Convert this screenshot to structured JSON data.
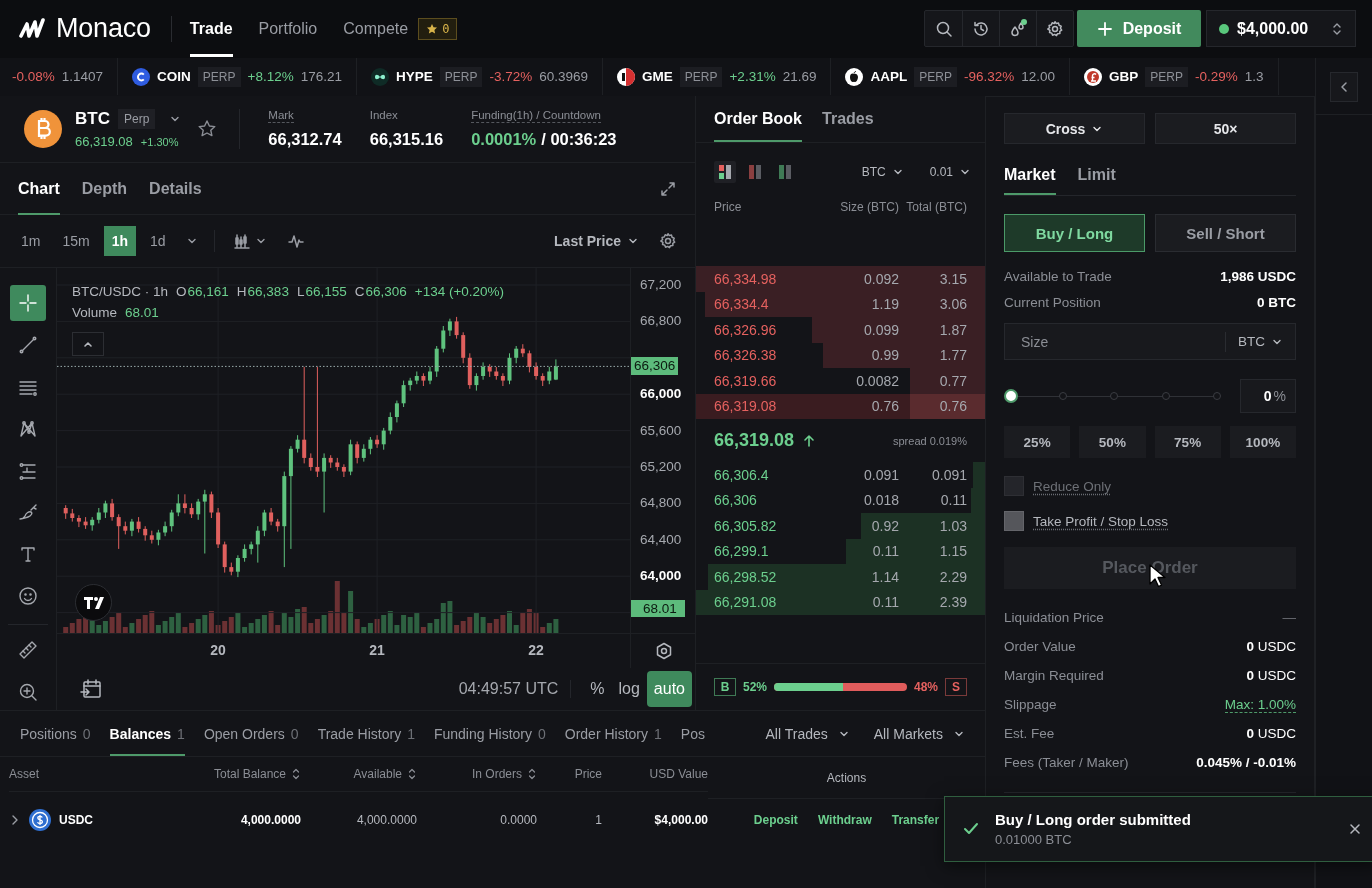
{
  "topbar": {
    "brand": "Monaco",
    "nav": [
      {
        "label": "Trade",
        "selected": true
      },
      {
        "label": "Portfolio",
        "selected": false
      },
      {
        "label": "Compete",
        "selected": false,
        "badge": "0"
      }
    ],
    "tool_buttons": [
      {
        "kind": "search",
        "alert": false
      },
      {
        "kind": "history",
        "alert": false
      },
      {
        "kind": "rewards",
        "alert": true
      },
      {
        "kind": "settings",
        "alert": false
      }
    ],
    "deposit_button": "Deposit",
    "account": {
      "balance": "$4,000.00",
      "connected": true
    }
  },
  "ticker": [
    {
      "change": "-0.08%",
      "rising": false,
      "price": "1.1407"
    },
    {
      "kind": "coin",
      "symbol": "COIN",
      "tag": "PERP",
      "change": "+8.12%",
      "rising": true,
      "price": "176.21"
    },
    {
      "kind": "hype",
      "symbol": "HYPE",
      "tag": "PERP",
      "change": "-3.72%",
      "rising": false,
      "price": "60.3969"
    },
    {
      "kind": "gme",
      "symbol": "GME",
      "tag": "PERP",
      "change": "+2.31%",
      "rising": true,
      "price": "21.69"
    },
    {
      "kind": "aapl",
      "symbol": "AAPL",
      "tag": "PERP",
      "change": "-96.32%",
      "rising": false,
      "price": "12.00"
    },
    {
      "kind": "gbp",
      "symbol": "GBP",
      "tag": "PERP",
      "change": "-0.29%",
      "rising": false,
      "price": "1.3"
    }
  ],
  "market": {
    "symbol": "BTC",
    "tag": "Perp",
    "price": "66,319.08",
    "change": "+1.30%",
    "rising": true,
    "favorite": false,
    "stats": [
      {
        "label": "Mark",
        "value": "66,312.74",
        "underlined": true,
        "positive": false
      },
      {
        "label": "Index",
        "value": "66,315.16",
        "underlined": false,
        "positive": false
      },
      {
        "label": "Funding(1h) / Countdown",
        "value": "0.0001%",
        "countdown": "/ 00:36:23",
        "underlined": true,
        "positive": true
      }
    ]
  },
  "chart_panel": {
    "tabs": [
      {
        "label": "Chart",
        "selected": true
      },
      {
        "label": "Depth",
        "selected": false
      },
      {
        "label": "Details",
        "selected": false
      }
    ],
    "intervals": [
      {
        "label": "1m",
        "selected": false
      },
      {
        "label": "15m",
        "selected": false
      },
      {
        "label": "1h",
        "selected": true
      },
      {
        "label": "1d",
        "selected": false
      }
    ],
    "price_source": "Last Price",
    "tools": [
      {
        "kind": "crosshair",
        "selected": true
      },
      {
        "kind": "trend-line",
        "selected": false
      },
      {
        "kind": "parallel-lines",
        "selected": false
      },
      {
        "kind": "pattern",
        "selected": false
      },
      {
        "kind": "position",
        "selected": false
      },
      {
        "kind": "brush",
        "selected": false
      },
      {
        "kind": "text",
        "selected": false
      },
      {
        "kind": "emoji",
        "selected": false
      },
      {
        "kind": "ruler",
        "selected": false
      },
      {
        "kind": "zoom",
        "selected": false
      }
    ],
    "legend": {
      "pair": "BTC/USDC · 1h",
      "ohlc": [
        {
          "key": "O",
          "value": "66,161"
        },
        {
          "key": "H",
          "value": "66,383"
        },
        {
          "key": "L",
          "value": "66,155"
        },
        {
          "key": "C",
          "value": "66,306"
        }
      ],
      "change": "+134 (+0.20%)",
      "volume_label": "Volume",
      "volume": "68.01"
    },
    "chart_data": {
      "type": "candlestick",
      "ylim": [
        63376,
        67387
      ],
      "yticks": [
        {
          "value": 67200,
          "label": "67,200"
        },
        {
          "value": 66800,
          "label": "66,800"
        },
        {
          "value": 66000,
          "label": "66,000"
        },
        {
          "value": 65600,
          "label": "65,600"
        },
        {
          "value": 65200,
          "label": "65,200"
        },
        {
          "value": 64800,
          "label": "64,800"
        },
        {
          "value": 64400,
          "label": "64,400"
        },
        {
          "value": 64000,
          "label": "64,000"
        }
      ],
      "xlim": [
        18.987,
        23.006
      ],
      "grid": true,
      "ref_lines": [
        {
          "axis": "y",
          "value": 66306,
          "label": "66,306"
        }
      ],
      "xticks": [
        {
          "value": 20,
          "label": "20"
        },
        {
          "value": 21,
          "label": "21"
        },
        {
          "value": 22,
          "label": "22"
        }
      ],
      "x": [
        19.0417,
        19.0833,
        19.125,
        19.1667,
        19.2083,
        19.25,
        19.2917,
        19.3333,
        19.375,
        19.4167,
        19.4583,
        19.5,
        19.5417,
        19.5833,
        19.625,
        19.6667,
        19.7083,
        19.75,
        19.7917,
        19.8333,
        19.875,
        19.9167,
        19.9583,
        20,
        20.0417,
        20.0833,
        20.125,
        20.1667,
        20.2083,
        20.25,
        20.2917,
        20.3333,
        20.375,
        20.4167,
        20.4583,
        20.5,
        20.5417,
        20.5833,
        20.625,
        20.6667,
        20.7083,
        20.75,
        20.7917,
        20.8333,
        20.875,
        20.9167,
        20.9583,
        21,
        21.0417,
        21.0833,
        21.125,
        21.1667,
        21.2083,
        21.25,
        21.2917,
        21.3333,
        21.375,
        21.4167,
        21.4583,
        21.5,
        21.5417,
        21.5833,
        21.625,
        21.6667,
        21.7083,
        21.75,
        21.7917,
        21.8333,
        21.875,
        21.9167,
        21.9583,
        22,
        22.0417,
        22.0833,
        22.125
      ],
      "ohlc": [
        [
          64750,
          64780,
          64630,
          64690
        ],
        [
          64690,
          64740,
          64600,
          64640
        ],
        [
          64640,
          64670,
          64540,
          64600
        ],
        [
          64600,
          64650,
          64520,
          64560
        ],
        [
          64560,
          64650,
          64500,
          64620
        ],
        [
          64620,
          64750,
          64580,
          64700
        ],
        [
          64700,
          64830,
          64640,
          64800
        ],
        [
          64800,
          64850,
          64610,
          64650
        ],
        [
          64650,
          64680,
          64300,
          64550
        ],
        [
          64550,
          64600,
          64460,
          64500
        ],
        [
          64500,
          64630,
          64440,
          64600
        ],
        [
          64600,
          64650,
          64480,
          64520
        ],
        [
          64520,
          64550,
          64390,
          64450
        ],
        [
          64450,
          64500,
          64360,
          64400
        ],
        [
          64400,
          64510,
          64340,
          64480
        ],
        [
          64480,
          64600,
          64440,
          64550
        ],
        [
          64550,
          64730,
          64490,
          64700
        ],
        [
          64700,
          64900,
          64660,
          64800
        ],
        [
          64800,
          64900,
          64690,
          64750
        ],
        [
          64750,
          64800,
          64640,
          64680
        ],
        [
          64680,
          64850,
          64620,
          64820
        ],
        [
          64820,
          64950,
          64250,
          64900
        ],
        [
          64900,
          64930,
          64640,
          64700
        ],
        [
          64700,
          64750,
          64310,
          64350
        ],
        [
          64350,
          64380,
          64040,
          64100
        ],
        [
          64100,
          64150,
          64010,
          64050
        ],
        [
          64050,
          64230,
          63990,
          64200
        ],
        [
          64200,
          64350,
          64160,
          64300
        ],
        [
          64300,
          64380,
          64240,
          64350
        ],
        [
          64350,
          64550,
          64150,
          64500
        ],
        [
          64500,
          64730,
          64440,
          64700
        ],
        [
          64700,
          64750,
          64560,
          64600
        ],
        [
          64600,
          64630,
          64490,
          64550
        ],
        [
          64550,
          65150,
          64100,
          65100
        ],
        [
          65100,
          65430,
          64300,
          65400
        ],
        [
          65400,
          65550,
          65360,
          65500
        ],
        [
          65500,
          66300,
          65240,
          65300
        ],
        [
          65300,
          65350,
          65160,
          65200
        ],
        [
          65200,
          66300,
          65090,
          65150
        ],
        [
          65150,
          65350,
          64700,
          65300
        ],
        [
          65300,
          65330,
          65190,
          65250
        ],
        [
          65250,
          65300,
          65160,
          65200
        ],
        [
          65200,
          65230,
          65090,
          65150
        ],
        [
          65150,
          65500,
          65110,
          65450
        ],
        [
          65450,
          65480,
          65240,
          65300
        ],
        [
          65300,
          65450,
          65260,
          65400
        ],
        [
          65400,
          65530,
          65340,
          65500
        ],
        [
          65500,
          65550,
          65410,
          65450
        ],
        [
          65450,
          65630,
          65390,
          65600
        ],
        [
          65600,
          65800,
          65560,
          65750
        ],
        [
          65750,
          65930,
          65690,
          65900
        ],
        [
          65900,
          66150,
          65860,
          66100
        ],
        [
          66100,
          66180,
          66040,
          66150
        ],
        [
          66150,
          66250,
          66110,
          66200
        ],
        [
          66200,
          66230,
          66090,
          66150
        ],
        [
          66150,
          66300,
          66110,
          66250
        ],
        [
          66250,
          66530,
          66190,
          66500
        ],
        [
          66500,
          66750,
          66460,
          66700
        ],
        [
          66700,
          66830,
          66640,
          66800
        ],
        [
          66800,
          66850,
          66610,
          66650
        ],
        [
          66650,
          66680,
          66340,
          66400
        ],
        [
          66400,
          66450,
          66060,
          66100
        ],
        [
          66100,
          66230,
          66040,
          66200
        ],
        [
          66200,
          66350,
          66160,
          66300
        ],
        [
          66300,
          66330,
          66190,
          66250
        ],
        [
          66250,
          66300,
          66160,
          66200
        ],
        [
          66200,
          66230,
          66090,
          66150
        ],
        [
          66150,
          66450,
          66110,
          66400
        ],
        [
          66400,
          66530,
          66340,
          66500
        ],
        [
          66500,
          66550,
          66410,
          66450
        ],
        [
          66450,
          66480,
          66240,
          66300
        ],
        [
          66300,
          66350,
          66160,
          66200
        ],
        [
          66200,
          66230,
          66090,
          66150
        ],
        [
          66150,
          66300,
          66110,
          66250
        ],
        [
          66161,
          66383,
          66155,
          66306
        ]
      ]
    },
    "volume_tag": "68.01",
    "time": "04:49:57 UTC",
    "scale_buttons": [
      {
        "label": "%",
        "selected": false
      },
      {
        "label": "log",
        "selected": false
      },
      {
        "label": "auto",
        "selected": true
      }
    ]
  },
  "order_book": {
    "tabs": [
      {
        "label": "Order Book",
        "selected": true
      },
      {
        "label": "Trades",
        "selected": false
      }
    ],
    "view_modes": [
      {
        "kind": "both",
        "selected": true
      },
      {
        "kind": "asks",
        "selected": false
      },
      {
        "kind": "bids",
        "selected": false
      }
    ],
    "unit": "BTC",
    "tick_size": "0.01",
    "columns": [
      "Price",
      "Size (BTC)",
      "Total (BTC)"
    ],
    "asks": [
      {
        "price": "66,334.98",
        "size": "0.092",
        "total": "3.15",
        "level": 1,
        "highlighted": false
      },
      {
        "price": "66,334.4",
        "size": "1.19",
        "total": "3.06",
        "level": 0.97,
        "highlighted": false
      },
      {
        "price": "66,326.96",
        "size": "0.099",
        "total": "1.87",
        "level": 0.6,
        "highlighted": false
      },
      {
        "price": "66,326.38",
        "size": "0.99",
        "total": "1.77",
        "level": 0.56,
        "highlighted": false
      },
      {
        "price": "66,319.66",
        "size": "0.0082",
        "total": "0.77",
        "level": 0.26,
        "highlighted": false
      },
      {
        "price": "66,319.08",
        "size": "0.76",
        "total": "0.76",
        "level": 0.26,
        "highlighted": true
      }
    ],
    "mid_price": "66,319.08",
    "mid_rising": true,
    "spread": "spread 0.019%",
    "bids": [
      {
        "price": "66,306.4",
        "size": "0.091",
        "total": "0.091",
        "level": 0.04,
        "highlighted": false
      },
      {
        "price": "66,306",
        "size": "0.018",
        "total": "0.11",
        "level": 0.05,
        "highlighted": false
      },
      {
        "price": "66,305.82",
        "size": "0.92",
        "total": "1.03",
        "level": 0.43,
        "highlighted": false
      },
      {
        "price": "66,299.1",
        "size": "0.11",
        "total": "1.15",
        "level": 0.48,
        "highlighted": false
      },
      {
        "price": "66,298.52",
        "size": "1.14",
        "total": "2.29",
        "level": 0.96,
        "highlighted": false
      },
      {
        "price": "66,291.08",
        "size": "0.11",
        "total": "2.39",
        "level": 1,
        "highlighted": false
      }
    ],
    "balance": {
      "buy_label": "B",
      "buy_percent": "52%",
      "level": 0.52,
      "sell_percent": "48%",
      "sell_label": "S"
    }
  },
  "order_form": {
    "margin_mode": "Cross",
    "leverage": "50×",
    "tabs": [
      {
        "label": "Market",
        "selected": true
      },
      {
        "label": "Limit",
        "selected": false
      }
    ],
    "sides": [
      {
        "label": "Buy / Long",
        "kind": "buy",
        "selected": true
      },
      {
        "label": "Sell / Short",
        "kind": "sell",
        "selected": false
      }
    ],
    "summary": [
      {
        "label": "Available to Trade",
        "value": "1,986 USDC"
      },
      {
        "label": "Current Position",
        "value": "0 BTC"
      }
    ],
    "size_field": {
      "placeholder": "Size",
      "unit": "BTC"
    },
    "slider": {
      "level": 0
    },
    "percent": {
      "value": "0",
      "unit": "%"
    },
    "presets": [
      "25%",
      "50%",
      "75%",
      "100%"
    ],
    "options": [
      {
        "label": "Reduce Only",
        "checked": false,
        "disabled": true
      },
      {
        "label": "Take Profit / Stop Loss",
        "checked": false,
        "disabled": false
      }
    ],
    "submit": {
      "label": "Place Order",
      "disabled": true
    },
    "details": [
      {
        "label": "Liquidation Price",
        "value": "—",
        "kind": "muted"
      },
      {
        "label": "Order Value",
        "value": "**0** USDC",
        "kind": "plain"
      },
      {
        "label": "Margin Required",
        "value": "**0** USDC",
        "kind": "plain"
      },
      {
        "label": "Slippage",
        "value": "Max: 1.00%",
        "kind": "link"
      },
      {
        "label": "Est. Fee",
        "value": "**0** USDC",
        "kind": "plain"
      },
      {
        "label": "Fees (Taker / Maker)",
        "value": "0.045% / -0.01%",
        "kind": "strong"
      }
    ]
  },
  "account_panel": {
    "tabs": [
      {
        "label": "Positions",
        "count": "0",
        "selected": false
      },
      {
        "label": "Balances",
        "count": "1",
        "selected": true
      },
      {
        "label": "Open Orders",
        "count": "0",
        "selected": false
      },
      {
        "label": "Trade History",
        "count": "1",
        "selected": false
      },
      {
        "label": "Funding History",
        "count": "0",
        "selected": false
      },
      {
        "label": "Order History",
        "count": "1",
        "selected": false
      },
      {
        "label": "Pos",
        "selected": false
      }
    ],
    "filters": [
      "All Trades",
      "All Markets"
    ],
    "columns": [
      {
        "label": "Asset",
        "sortable": false
      },
      {
        "label": "Total Balance",
        "sortable": true
      },
      {
        "label": "Available",
        "sortable": true
      },
      {
        "label": "In Orders",
        "sortable": true
      },
      {
        "label": "Price",
        "sortable": false
      },
      {
        "label": "USD Value",
        "sortable": false
      },
      {
        "label": "Actions",
        "sortable": false
      }
    ],
    "rows": [
      {
        "asset": "USDC",
        "total": "4,000.0000",
        "available": "4,000.0000",
        "in_orders": "0.0000",
        "price": "1",
        "usd_value": "$4,000.00",
        "expanded": false,
        "actions": [
          "Deposit",
          "Withdraw",
          "Transfer"
        ]
      }
    ]
  },
  "toast": {
    "kind": "success",
    "title": "Buy / Long order submitted",
    "detail": "0.01000 BTC"
  }
}
